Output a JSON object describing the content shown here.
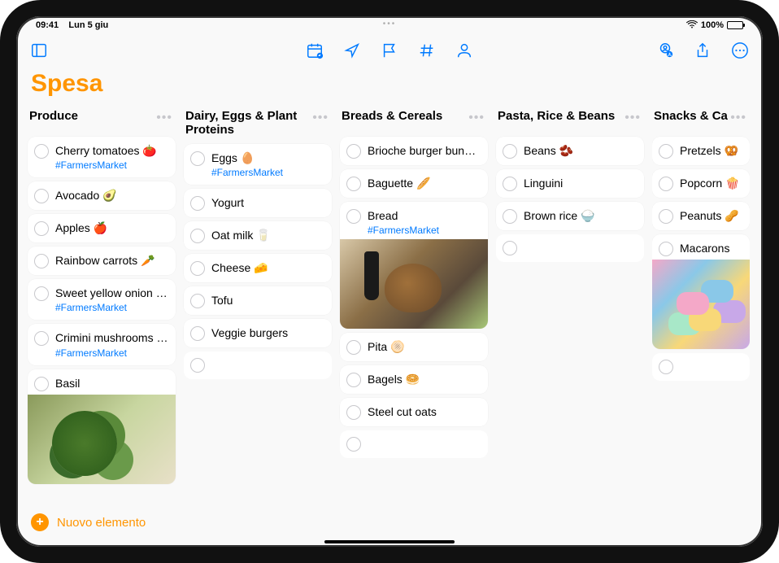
{
  "status": {
    "time": "09:41",
    "date": "Lun 5 giu",
    "battery_pct": "100%"
  },
  "title": "Spesa",
  "new_item_label": "Nuovo elemento",
  "tag_farmers": "#FarmersMarket",
  "columns": [
    {
      "title": "Produce",
      "items": [
        {
          "label": "Cherry tomatoes 🍅",
          "tag": true
        },
        {
          "label": "Avocado 🥑"
        },
        {
          "label": "Apples 🍎"
        },
        {
          "label": "Rainbow carrots 🥕"
        },
        {
          "label": "Sweet yellow onion 🧅",
          "tag": true
        },
        {
          "label": "Crimini mushrooms 🍄",
          "tag": true
        },
        {
          "label": "Basil",
          "image": "basil"
        }
      ]
    },
    {
      "title": "Dairy, Eggs & Plant Proteins",
      "items": [
        {
          "label": "Eggs 🥚",
          "tag": true
        },
        {
          "label": "Yogurt"
        },
        {
          "label": "Oat milk 🥛"
        },
        {
          "label": "Cheese 🧀"
        },
        {
          "label": "Tofu"
        },
        {
          "label": "Veggie burgers"
        }
      ],
      "empty_trailing": true
    },
    {
      "title": "Breads & Cereals",
      "items": [
        {
          "label": "Brioche burger buns 🍔"
        },
        {
          "label": "Baguette 🥖"
        },
        {
          "label": "Bread",
          "tag": true,
          "image": "bread"
        },
        {
          "label": "Pita 🫓"
        },
        {
          "label": "Bagels 🥯"
        },
        {
          "label": "Steel cut oats"
        }
      ],
      "empty_trailing": true
    },
    {
      "title": "Pasta, Rice & Beans",
      "items": [
        {
          "label": "Beans 🫘"
        },
        {
          "label": "Linguini"
        },
        {
          "label": "Brown rice 🍚"
        }
      ],
      "empty_trailing": true
    },
    {
      "title": "Snacks & Candy",
      "title_clip": "Snacks & Ca",
      "items": [
        {
          "label": "Pretzels 🥨"
        },
        {
          "label": "Popcorn 🍿"
        },
        {
          "label": "Peanuts 🥜"
        },
        {
          "label": "Macarons",
          "image": "macarons"
        }
      ],
      "empty_trailing": true
    }
  ]
}
